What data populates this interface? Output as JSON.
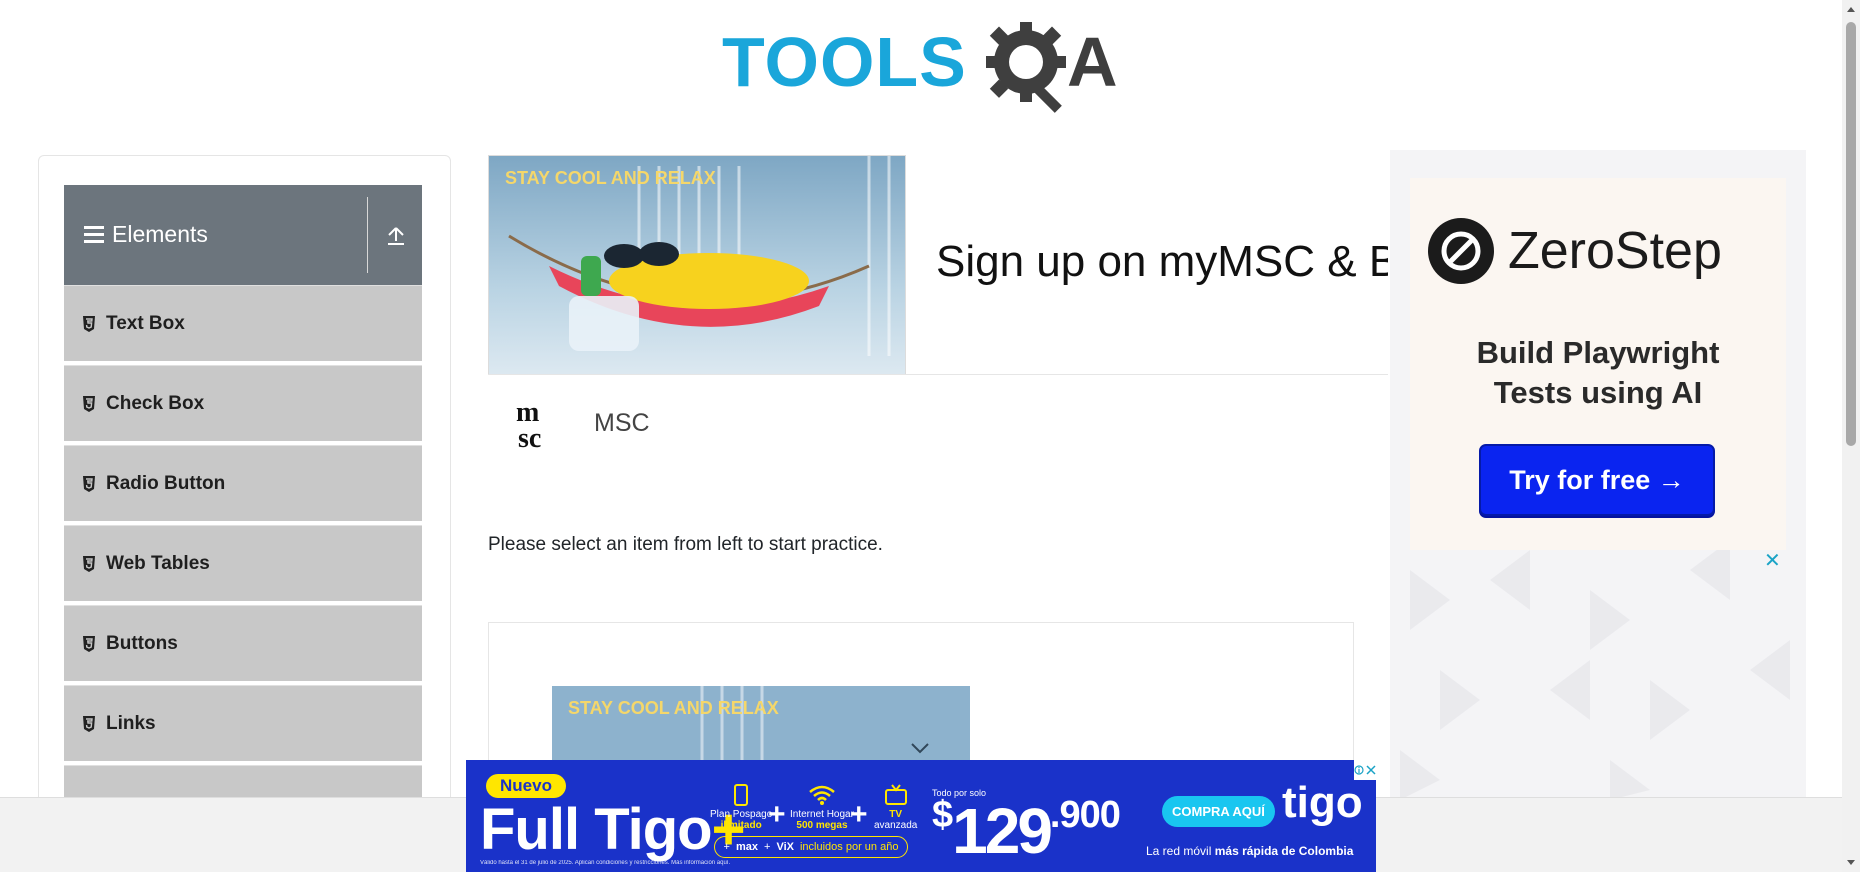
{
  "header": {
    "logo_left": "TOOLS",
    "logo_right": "A"
  },
  "sidebar": {
    "group_title": "Elements",
    "items": [
      {
        "label": "Text Box"
      },
      {
        "label": "Check Box"
      },
      {
        "label": "Radio Button"
      },
      {
        "label": "Web Tables"
      },
      {
        "label": "Buttons"
      },
      {
        "label": "Links"
      },
      {
        "label": ""
      }
    ]
  },
  "main_ad": {
    "image_caption": "STAY COOL AND RELAX",
    "headline": "Sign up on myMSC & B",
    "brand_logo_text": "msc",
    "brand_name": "MSC"
  },
  "main": {
    "prompt": "Please select an item from left to start practice."
  },
  "second_ad": {
    "image_caption": "STAY COOL AND RELAX"
  },
  "right_ad": {
    "brand": "ZeroStep",
    "tagline_line1": "Build Playwright",
    "tagline_line2": "Tests using AI",
    "cta": "Try for free →",
    "close": "✕"
  },
  "bottom_ad": {
    "badge": "Nuevo",
    "full": "Full",
    "tigo_word": "Tigo",
    "plus_mark": "+",
    "item1_top": "Plan Pospago",
    "item1_bottom": "ilimitado",
    "item2_top": "Internet Hogar",
    "item2_bottom": "500 megas",
    "item3_top": "TV",
    "item3_bottom": "avanzada",
    "pill_max": "max",
    "pill_vix": "ViX",
    "pill_text": "incluidos por un año",
    "price_pre": "Todo por solo",
    "price_dollar": "$",
    "price_main": "129",
    "price_cents": ".900",
    "cta": "COMPRA AQUÍ",
    "logo": "tigo",
    "slogan_pre": "La red móvil",
    "slogan_bold": "más rápida de Colombia",
    "fine_print": "Válido hasta el 31 de julio de 2025. Aplican condiciones y restricciones. Más información aquí."
  },
  "colors": {
    "accent_blue": "#1aa6da",
    "sidebar_header": "#6c757d",
    "sidebar_item": "#c8c8c8",
    "zerostep_cta": "#0a24f0",
    "tigo_blue": "#1a32c9",
    "tigo_yellow": "#ffe600"
  },
  "icons": {
    "gear": "gear-magnifier-icon",
    "hamburger": "hamburger-icon",
    "toggle": "collapse-arrow-icon",
    "menu_item": "html5-shield-icon",
    "ad_choices": "ad-choices-icon",
    "close": "close-icon"
  }
}
